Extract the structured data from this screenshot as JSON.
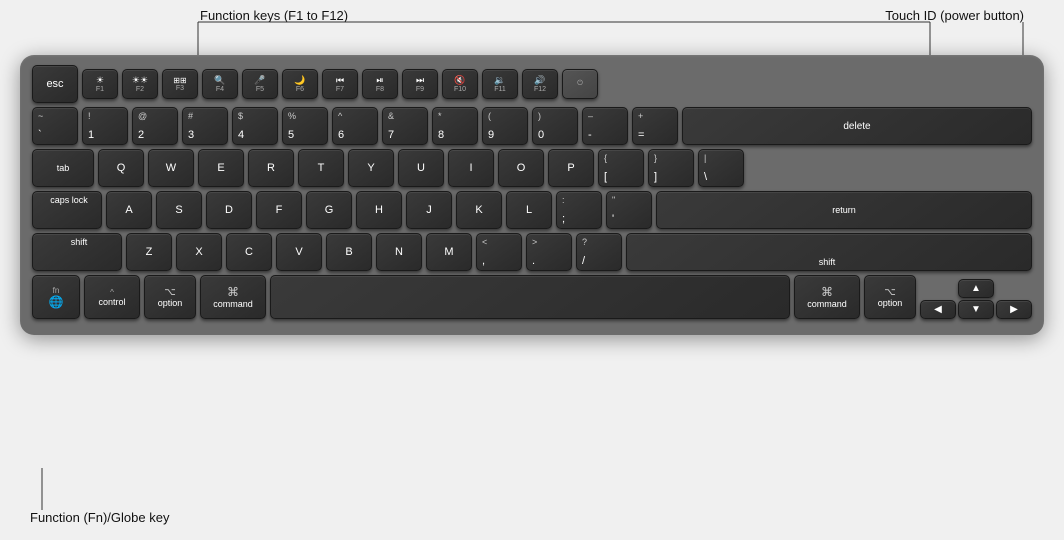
{
  "annotations": {
    "function_keys_label": "Function keys (F1 to F12)",
    "touch_id_label": "Touch ID (power button)",
    "fn_globe_label": "Function (Fn)/Globe key"
  },
  "keyboard": {
    "rows": {
      "fn_row": [
        "esc",
        "F1",
        "F2",
        "F3",
        "F4",
        "F5",
        "F6",
        "F7",
        "F8",
        "F9",
        "F10",
        "F11",
        "F12",
        "touch_id"
      ],
      "num_row": [
        "~`",
        "!1",
        "@2",
        "#3",
        "$4",
        "%5",
        "^6",
        "&7",
        "*8",
        "(9",
        ")0",
        "_-",
        "+=",
        "delete"
      ],
      "qwerty_row": [
        "tab",
        "Q",
        "W",
        "E",
        "R",
        "T",
        "Y",
        "U",
        "I",
        "O",
        "P",
        "{[",
        "}]",
        "|\\"
      ],
      "home_row": [
        "caps lock",
        "A",
        "S",
        "D",
        "F",
        "G",
        "H",
        "J",
        "K",
        "L",
        ":;",
        "'\"",
        "return"
      ],
      "shift_row": [
        "shift",
        "Z",
        "X",
        "C",
        "V",
        "B",
        "N",
        "M",
        "<,",
        ">.",
        "?/",
        "shift"
      ],
      "bottom_row": [
        "fn/globe",
        "control",
        "option",
        "command",
        "space",
        "command",
        "option",
        "arrows"
      ]
    }
  }
}
